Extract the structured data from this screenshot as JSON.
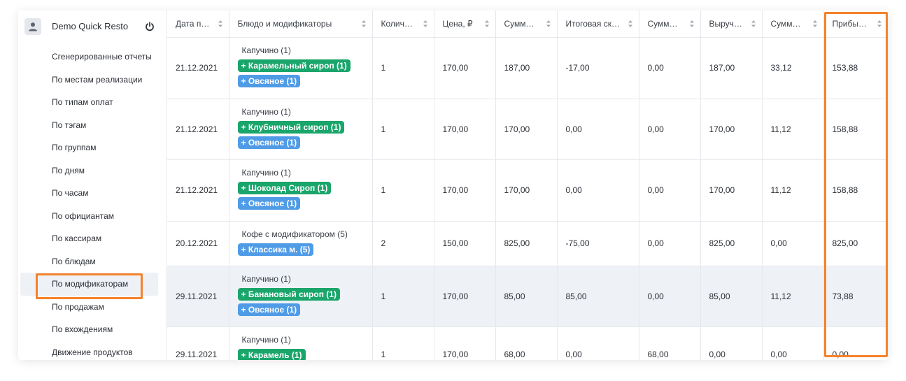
{
  "user": {
    "name": "Demo Quick Resto"
  },
  "menu": [
    {
      "label": "Сгенерированные отчеты"
    },
    {
      "label": "По местам реализации"
    },
    {
      "label": "По типам оплат"
    },
    {
      "label": "По тэгам"
    },
    {
      "label": "По группам"
    },
    {
      "label": "По дням"
    },
    {
      "label": "По часам"
    },
    {
      "label": "По официантам"
    },
    {
      "label": "По кассирам"
    },
    {
      "label": "По блюдам"
    },
    {
      "label": "По модификаторам"
    },
    {
      "label": "По продажам"
    },
    {
      "label": "По вхождениям"
    },
    {
      "label": "Движение продуктов"
    }
  ],
  "columns": [
    "Дата пр...",
    "Блюдо и модификаторы",
    "Количес...",
    "Цена, ₽",
    "Сумма п...",
    "Итоговая ски...",
    "Сумма в...",
    "Выручка...",
    "Сумма с...",
    "Прибыл..."
  ],
  "rows": [
    {
      "date": "21.12.2021",
      "dish": "Капучино (1)",
      "tags": [
        {
          "text": "+ Карамельный сироп (1)",
          "color": "green"
        },
        {
          "text": "+ Овсяное (1)",
          "color": "blue"
        }
      ],
      "qty": "1",
      "price": "170,00",
      "sum": "187,00",
      "discount": "-17,00",
      "sumv": "0,00",
      "revenue": "187,00",
      "cost": "33,12",
      "profit": "153,88"
    },
    {
      "date": "21.12.2021",
      "dish": "Капучино (1)",
      "tags": [
        {
          "text": "+ Клубничный сироп (1)",
          "color": "green"
        },
        {
          "text": "+ Овсяное (1)",
          "color": "blue"
        }
      ],
      "qty": "1",
      "price": "170,00",
      "sum": "170,00",
      "discount": "0,00",
      "sumv": "0,00",
      "revenue": "170,00",
      "cost": "11,12",
      "profit": "158,88"
    },
    {
      "date": "21.12.2021",
      "dish": "Капучино (1)",
      "tags": [
        {
          "text": "+ Шоколад Сироп (1)",
          "color": "green"
        },
        {
          "text": "+ Овсяное (1)",
          "color": "blue"
        }
      ],
      "qty": "1",
      "price": "170,00",
      "sum": "170,00",
      "discount": "0,00",
      "sumv": "0,00",
      "revenue": "170,00",
      "cost": "11,12",
      "profit": "158,88"
    },
    {
      "date": "20.12.2021",
      "dish": "Кофе с модификатором (5)",
      "tags": [
        {
          "text": "+ Классика м. (5)",
          "color": "blue"
        }
      ],
      "qty": "2",
      "price": "150,00",
      "sum": "825,00",
      "discount": "-75,00",
      "sumv": "0,00",
      "revenue": "825,00",
      "cost": "0,00",
      "profit": "825,00"
    },
    {
      "date": "29.11.2021",
      "dish": "Капучино (1)",
      "tags": [
        {
          "text": "+ Банановый сироп (1)",
          "color": "green"
        },
        {
          "text": "+ Овсяное (1)",
          "color": "blue"
        }
      ],
      "qty": "1",
      "price": "170,00",
      "sum": "85,00",
      "discount": "85,00",
      "sumv": "0,00",
      "revenue": "85,00",
      "cost": "11,12",
      "profit": "73,88",
      "hover": true
    },
    {
      "date": "29.11.2021",
      "dish": "Капучино (1)",
      "tags": [
        {
          "text": "+ Карамель (1)",
          "color": "green"
        }
      ],
      "qty": "1",
      "price": "170,00",
      "sum": "68,00",
      "discount": "0,00",
      "sumv": "68,00",
      "revenue": "0,00",
      "cost": "0,00",
      "profit": "0,00"
    }
  ],
  "colors": {
    "accent_highlight": "#f5822a",
    "tag_green": "#1aa56b",
    "tag_blue": "#4f9be6"
  },
  "icons": {
    "avatar": "user-icon",
    "power": "power-icon",
    "sort": "sort-icon"
  }
}
